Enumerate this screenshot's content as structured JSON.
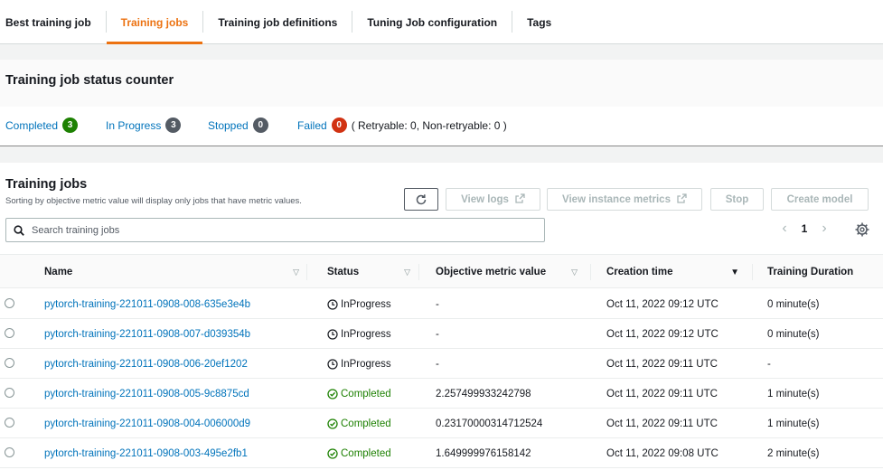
{
  "tabs": [
    {
      "label": "Best training job",
      "active": false
    },
    {
      "label": "Training jobs",
      "active": true
    },
    {
      "label": "Training job definitions",
      "active": false
    },
    {
      "label": "Tuning Job configuration",
      "active": false
    },
    {
      "label": "Tags",
      "active": false
    }
  ],
  "status_counter": {
    "title": "Training job status counter",
    "completed": {
      "label": "Completed",
      "count": "3"
    },
    "in_progress": {
      "label": "In Progress",
      "count": "3"
    },
    "stopped": {
      "label": "Stopped",
      "count": "0"
    },
    "failed": {
      "label": "Failed",
      "count": "0",
      "detail": "( Retryable: 0, Non-retryable: 0 )"
    }
  },
  "training_jobs": {
    "title": "Training jobs",
    "description": "Sorting by objective metric value will display only jobs that have metric values.",
    "buttons": {
      "view_logs": "View logs",
      "view_instance_metrics": "View instance metrics",
      "stop": "Stop",
      "create_model": "Create model"
    },
    "search": {
      "placeholder": "Search training jobs",
      "value": ""
    },
    "pagination": {
      "current_page": "1"
    },
    "columns": [
      "Name",
      "Status",
      "Objective metric value",
      "Creation time",
      "Training Duration"
    ],
    "rows": [
      {
        "name": "pytorch-training-221011-0908-008-635e3e4b",
        "status": "InProgress",
        "metric": "-",
        "created": "Oct 11, 2022 09:12 UTC",
        "duration": "0 minute(s)"
      },
      {
        "name": "pytorch-training-221011-0908-007-d039354b",
        "status": "InProgress",
        "metric": "-",
        "created": "Oct 11, 2022 09:12 UTC",
        "duration": "0 minute(s)"
      },
      {
        "name": "pytorch-training-221011-0908-006-20ef1202",
        "status": "InProgress",
        "metric": "-",
        "created": "Oct 11, 2022 09:11 UTC",
        "duration": "-"
      },
      {
        "name": "pytorch-training-221011-0908-005-9c8875cd",
        "status": "Completed",
        "metric": "2.257499933242798",
        "created": "Oct 11, 2022 09:11 UTC",
        "duration": "1 minute(s)"
      },
      {
        "name": "pytorch-training-221011-0908-004-006000d9",
        "status": "Completed",
        "metric": "0.23170000314712524",
        "created": "Oct 11, 2022 09:11 UTC",
        "duration": "1 minute(s)"
      },
      {
        "name": "pytorch-training-221011-0908-003-495e2fb1",
        "status": "Completed",
        "metric": "1.649999976158142",
        "created": "Oct 11, 2022 09:08 UTC",
        "duration": "2 minute(s)"
      }
    ]
  },
  "colors": {
    "accent": "#ec7211",
    "link": "#0073bb",
    "success": "#1d8102",
    "neutral_badge": "#545b64",
    "error": "#d13212"
  }
}
